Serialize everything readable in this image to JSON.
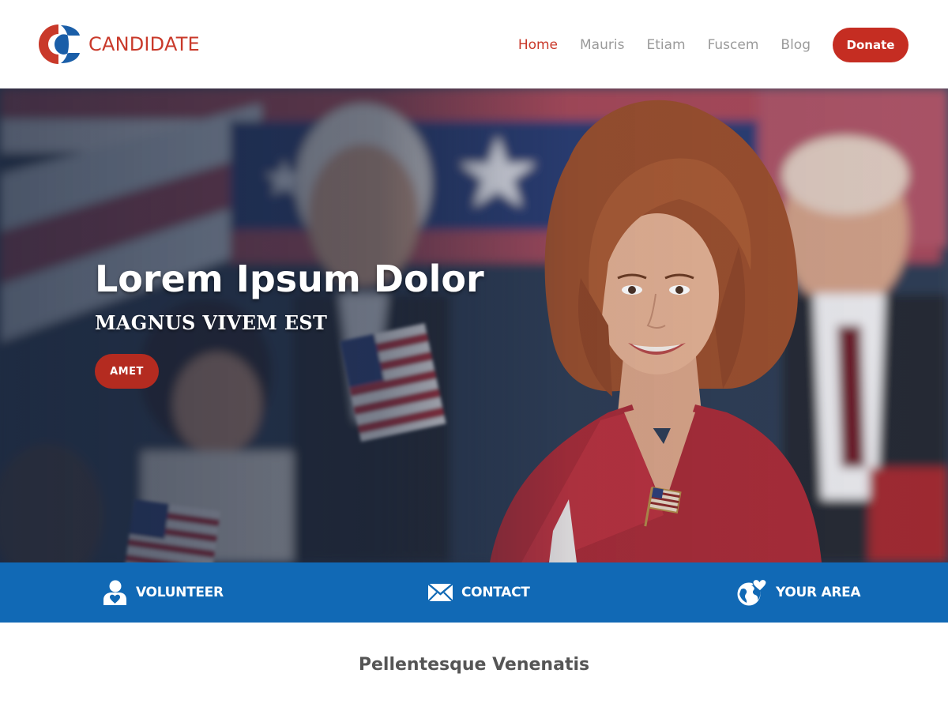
{
  "brand": {
    "name": "CANDIDATE",
    "logo_icon": "candidate-logo-icon",
    "color": "#c9392a",
    "accent": "#1a5ea8"
  },
  "nav": {
    "items": [
      {
        "label": "Home",
        "active": true
      },
      {
        "label": "Mauris",
        "active": false
      },
      {
        "label": "Etiam",
        "active": false
      },
      {
        "label": "Fuscem",
        "active": false
      },
      {
        "label": "Blog",
        "active": false
      }
    ],
    "donate_label": "Donate"
  },
  "hero": {
    "title": "Lorem Ipsum Dolor",
    "subtitle": "MAGNUS VIVEM EST",
    "button_label": "AMET"
  },
  "actions": [
    {
      "label": "VOLUNTEER",
      "icon": "volunteer-icon"
    },
    {
      "label": "CONTACT",
      "icon": "envelope-icon"
    },
    {
      "label": "YOUR AREA",
      "icon": "globe-heart-icon"
    }
  ],
  "section": {
    "title": "Pellentesque Venenatis"
  },
  "colors": {
    "primary_red": "#c52d22",
    "action_blue": "#1169b5",
    "nav_gray": "#9a9a9a"
  }
}
